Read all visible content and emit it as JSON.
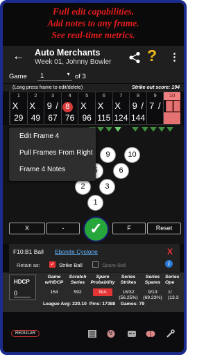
{
  "promo": {
    "line1": "Full edit capabilities.",
    "line2": "Add notes to any frame.",
    "line3": "See real-time metrics."
  },
  "appbar": {
    "title": "Auto Merchants",
    "subtitle": "Week 01, Johnny Bowler",
    "back_icon": "back-arrow-icon",
    "help_symbol": "?",
    "more_symbol": "⋮"
  },
  "game_row": {
    "label": "Game",
    "selected": "1",
    "of_text": "of 3"
  },
  "hint": {
    "text": "(Long press frame to edit/delete)",
    "strikeout": "Strike out score: 194"
  },
  "scoreboard": {
    "frames": [
      "1",
      "2",
      "3",
      "4",
      "5",
      "6",
      "7",
      "8",
      "9",
      "10"
    ],
    "balls": [
      [
        "X",
        ""
      ],
      [
        "X",
        ""
      ],
      [
        "9",
        "/"
      ],
      [
        "8",
        ""
      ],
      [
        "X",
        ""
      ],
      [
        "X",
        ""
      ],
      [
        "X",
        ""
      ],
      [
        "9",
        "/"
      ],
      [
        "7",
        "/"
      ],
      [
        "",
        ""
      ]
    ],
    "circled": "8",
    "totals": [
      "29",
      "49",
      "67",
      "76",
      "96",
      "115",
      "124",
      "144",
      "",
      ""
    ],
    "selected_frame": "10"
  },
  "context_menu": {
    "items": [
      "Edit Frame 4",
      "Pull Frames From Right",
      "Frame 4 Notes"
    ]
  },
  "pins": [
    "1",
    "2",
    "3",
    "4",
    "5",
    "6",
    "7",
    "8",
    "9",
    "10"
  ],
  "actions": {
    "x": "X",
    "minus": "-",
    "ok": "✓",
    "f": "F",
    "reset": "Reset"
  },
  "ball_panel": {
    "frame_ball": "F10:B1 Ball",
    "ball_name": "Ebonite Cyclone",
    "close": "X",
    "retain_label": "Retain as:",
    "strike_ball": "Strike Ball",
    "spare_ball": "Spare Ball",
    "info": "i"
  },
  "stats": {
    "hdcp_label": "HDCP",
    "hdcp_value": "0",
    "columns": [
      {
        "h1": "Game",
        "h2": "w/HDCP",
        "value": "154",
        "value2": ""
      },
      {
        "h1": "Scratch",
        "h2": "Series",
        "value": "592",
        "value2": ""
      },
      {
        "h1": "Spare",
        "h2": "Probability",
        "value": "N/A",
        "value2": ""
      },
      {
        "h1": "Series",
        "h2": "Strikes",
        "value": "18/32",
        "value2": "(56.25%)"
      },
      {
        "h1": "Series",
        "h2": "Spares",
        "value": "9/13",
        "value2": "(69.23%)"
      },
      {
        "h1": "Series",
        "h2": "Ope",
        "value": "1/",
        "value2": "(13.3"
      }
    ],
    "league_avg": "League Avg: 220.10",
    "pins": "Pins: 17388",
    "games": "Games: 79"
  },
  "bottom_nav": {
    "badge": "REGULAR"
  }
}
